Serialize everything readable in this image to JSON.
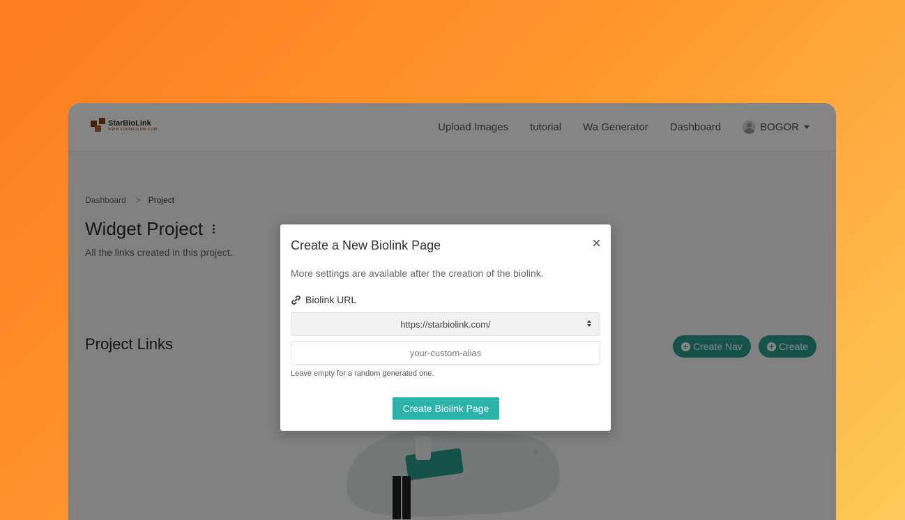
{
  "brand": {
    "name": "StarBioLink",
    "tagline": "WWW.STARBIOLINK.COM"
  },
  "nav": {
    "links": [
      "Upload Images",
      "tutorial",
      "Wa Generator",
      "Dashboard"
    ],
    "user": "BOGOR"
  },
  "breadcrumb": {
    "items": [
      "Dashboard",
      "Project"
    ],
    "separator": ">"
  },
  "page": {
    "title": "Widget Project",
    "subtitle": "All the links created in this project.",
    "section_title": "Project Links",
    "create_nav_label": "Create Nav",
    "create_label": "Create"
  },
  "modal": {
    "title": "Create a New Biolink Page",
    "close": "×",
    "description": "More settings are available after the creation of the biolink.",
    "url_label": "Biolink URL",
    "domain_value": "https://starbiolink.com/",
    "alias_placeholder": "your-custom-alias",
    "hint": "Leave empty for a random generated one.",
    "submit_label": "Create Biolink Page"
  },
  "colors": {
    "accent": "#2a9d8f",
    "modal_button": "#2ab3a8",
    "background_gradient_start": "#ff7a1e",
    "background_gradient_end": "#ffc85a"
  },
  "icons": {
    "link": "link-icon",
    "close": "close-icon",
    "plus": "plus-circle-icon",
    "more": "kebab-menu-icon",
    "caret": "caret-down-icon",
    "avatar": "user-avatar-icon"
  }
}
